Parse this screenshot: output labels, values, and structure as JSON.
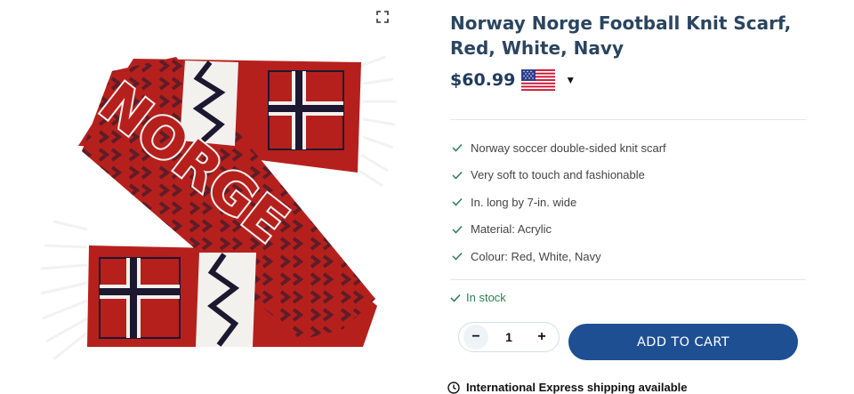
{
  "product": {
    "title": "Norway Norge Football Knit Scarf, Red, White, Navy",
    "price": "$60.99",
    "currency_flag_icon": "us-flag-icon",
    "currency_dropdown_icon": "caret-down-icon",
    "features": [
      "Norway soccer double-sided knit scarf",
      "Very soft to touch and fashionable",
      "In. long by 7-in. wide",
      "Material: Acrylic",
      "Colour: Red, White, Navy"
    ],
    "stock_status": "In stock",
    "quantity": "1",
    "quantity_minus": "−",
    "quantity_plus": "+",
    "add_to_cart_label": "ADD TO CART",
    "shipping_note": "International Express shipping available"
  },
  "image": {
    "scarf_text": "NORGE",
    "zoom_icon": "expand-icon"
  },
  "colors": {
    "brand": "#1e4f93",
    "title": "#2b4560",
    "in_stock": "#2e7d4f",
    "scarf_red": "#b5201d",
    "scarf_navy": "#1b1830"
  }
}
